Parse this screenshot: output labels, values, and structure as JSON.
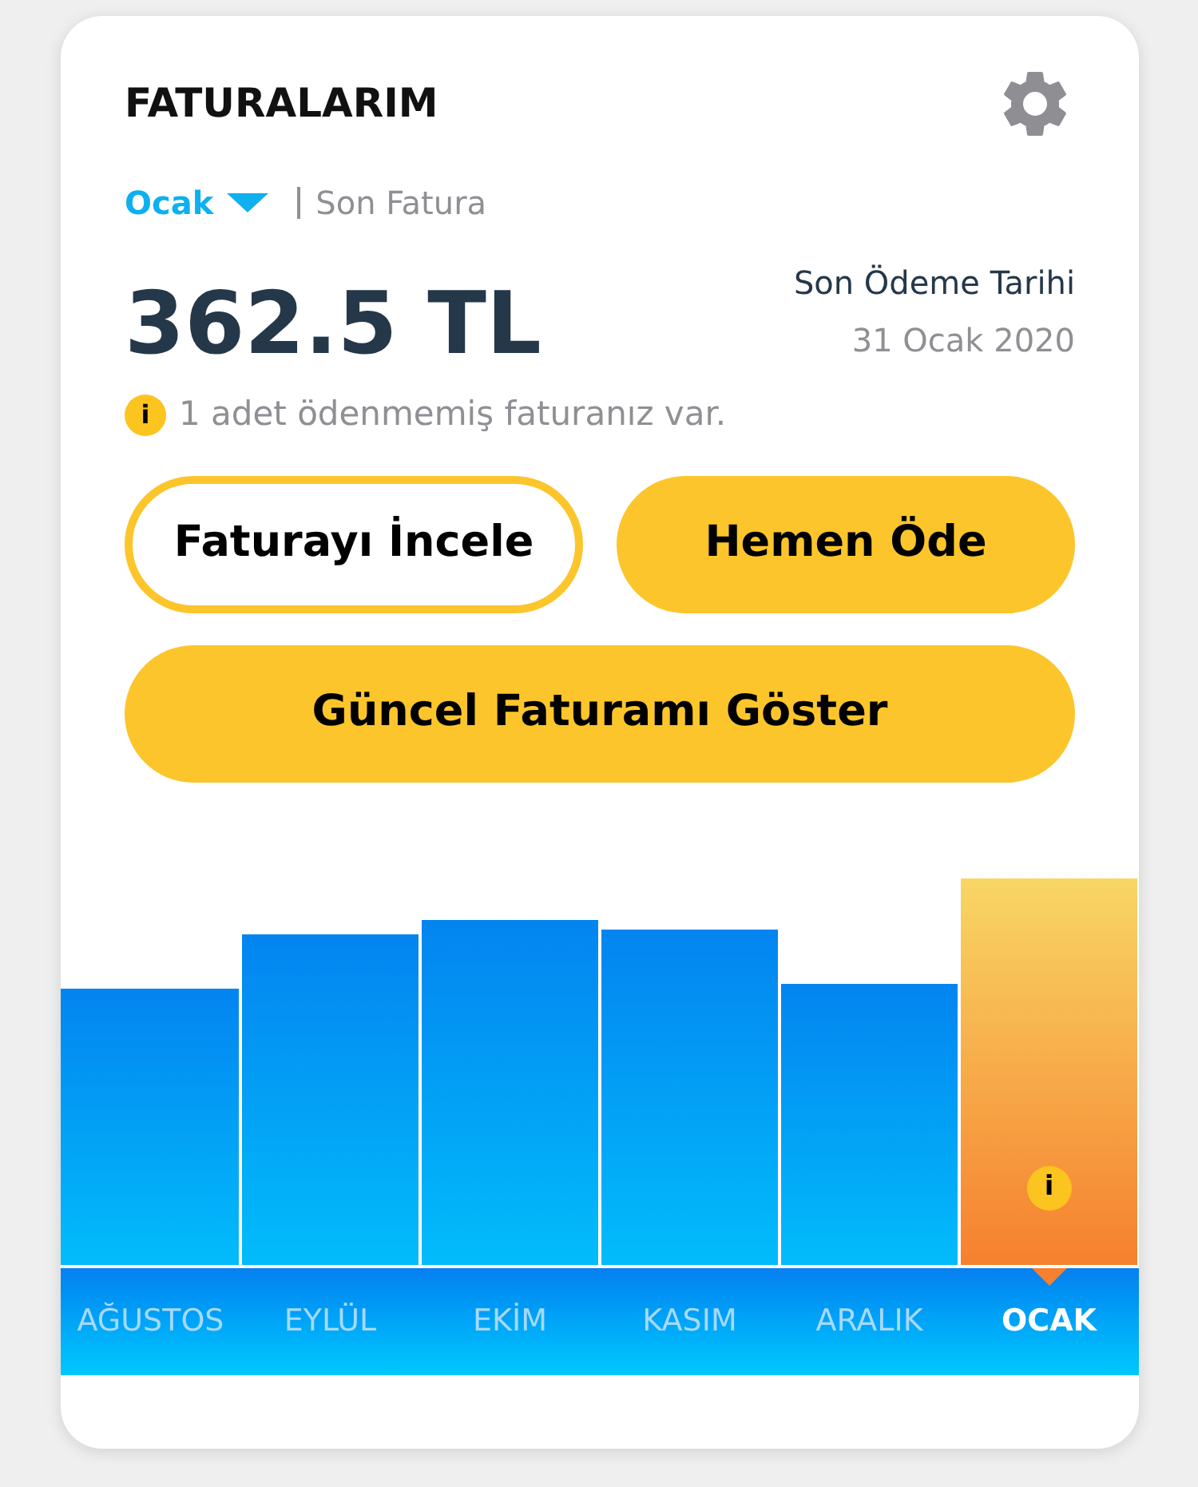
{
  "header": {
    "title": "FATURALARIM"
  },
  "period": {
    "month": "Ocak",
    "label": "Son Fatura"
  },
  "amount": "362.5 TL",
  "due": {
    "label": "Son Ödeme Tarihi",
    "date": "31 Ocak 2020"
  },
  "notice": {
    "icon_text": "i",
    "text": "1 adet ödenmemiş faturanız var."
  },
  "buttons": [
    {
      "label": "Faturayı İncele",
      "kind": "outline"
    },
    {
      "label": "Hemen Öde",
      "kind": "filled"
    },
    {
      "label": "Güncel Faturamı Göster",
      "kind": "filled"
    }
  ],
  "chart_marker": {
    "icon_text": "i"
  },
  "months": [
    {
      "label": "AĞUSTOS",
      "selected": false
    },
    {
      "label": "EYLÜL",
      "selected": false
    },
    {
      "label": "EKİM",
      "selected": false
    },
    {
      "label": "KASIM",
      "selected": false
    },
    {
      "label": "ARALIK",
      "selected": false
    },
    {
      "label": "OCAK",
      "selected": true
    }
  ]
}
